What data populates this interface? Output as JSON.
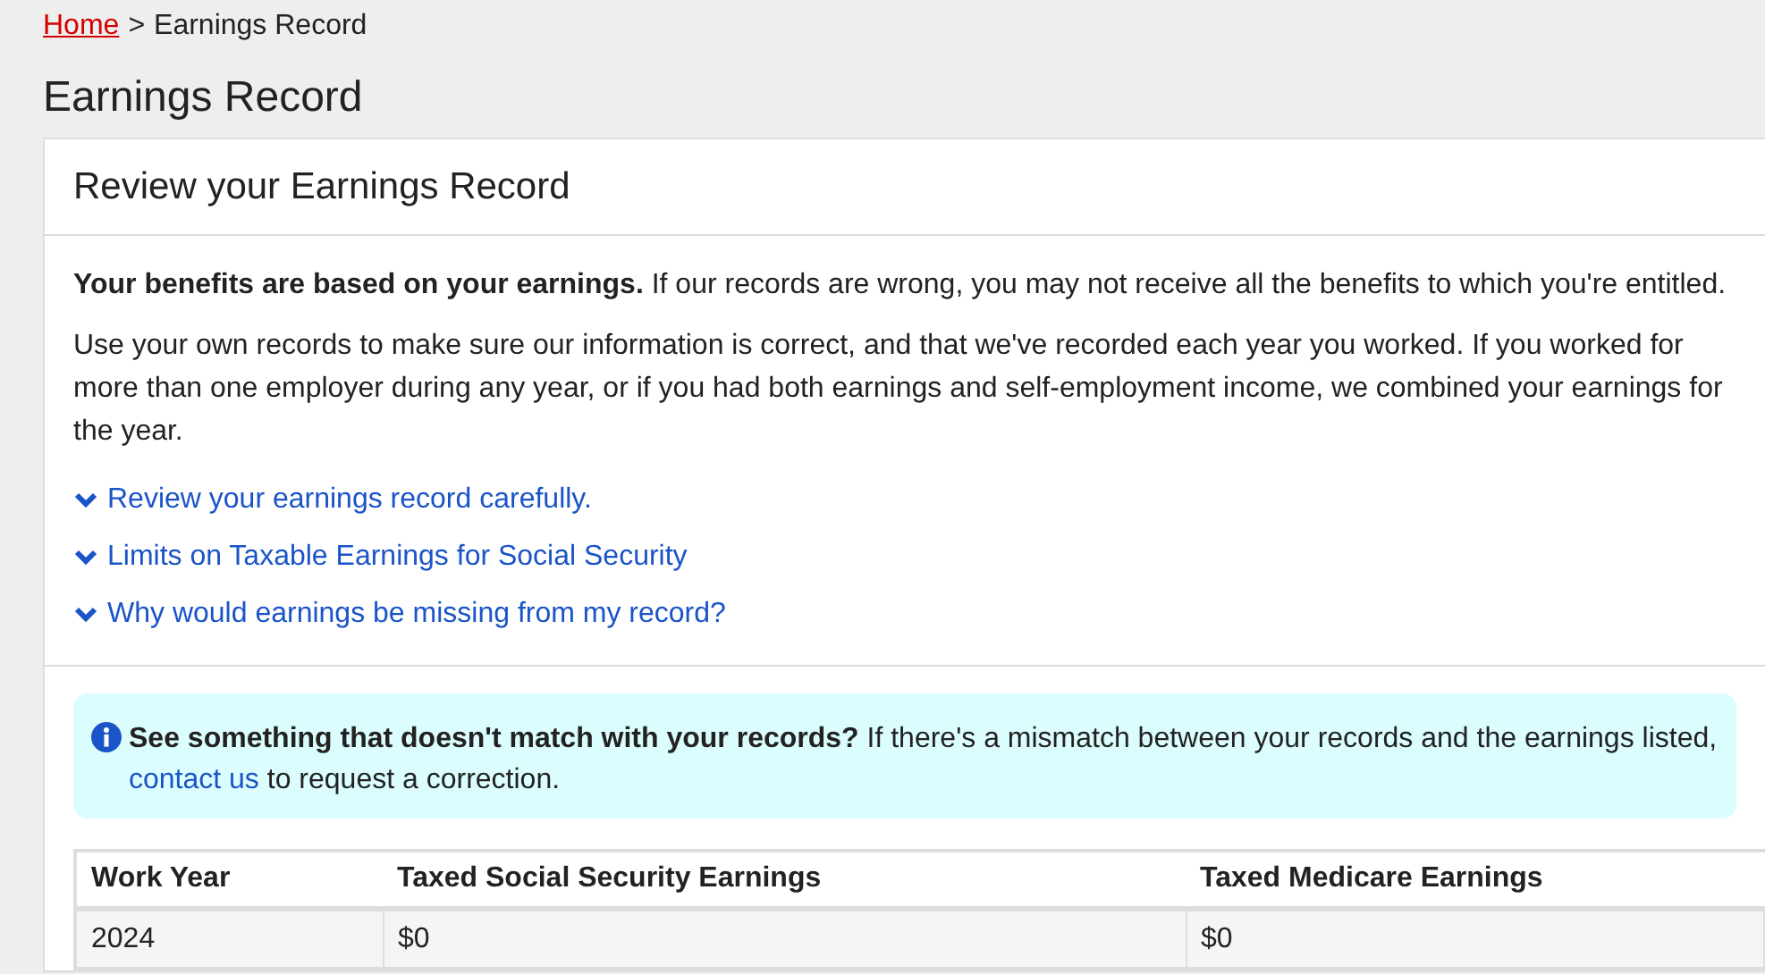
{
  "breadcrumb": {
    "home": "Home",
    "separator": ">",
    "current": "Earnings Record"
  },
  "page_title": "Earnings Record",
  "card": {
    "title": "Review your Earnings Record",
    "paragraphs": [
      "**Your benefits are based on your earnings.** If our records are wrong, you may not receive all the benefits to which you're entitled.",
      "Use your own records to make sure our information is correct, and that we've recorded each year you worked. If you worked for more than one employer during any year, or if you had both earnings and self-employment income, we combined your earnings for the year."
    ],
    "expanders": [
      {
        "label": "Review your earnings record carefully.",
        "expanded": false
      },
      {
        "label": "Limits on Taxable Earnings for Social Security",
        "expanded": false
      },
      {
        "label": "Why would earnings be missing from my record?",
        "expanded": false
      }
    ],
    "alert": {
      "text_before": "**See something that doesn't match with your records?** If there's a mismatch between your records and the earnings listed,",
      "link": "contact us",
      "text_after": "to request a correction."
    },
    "table": {
      "columns": [
        "Work Year",
        "Taxed Social Security Earnings",
        "Taxed Medicare Earnings"
      ],
      "rows": [
        [
          "2024",
          "$0",
          "$0"
        ]
      ]
    }
  }
}
